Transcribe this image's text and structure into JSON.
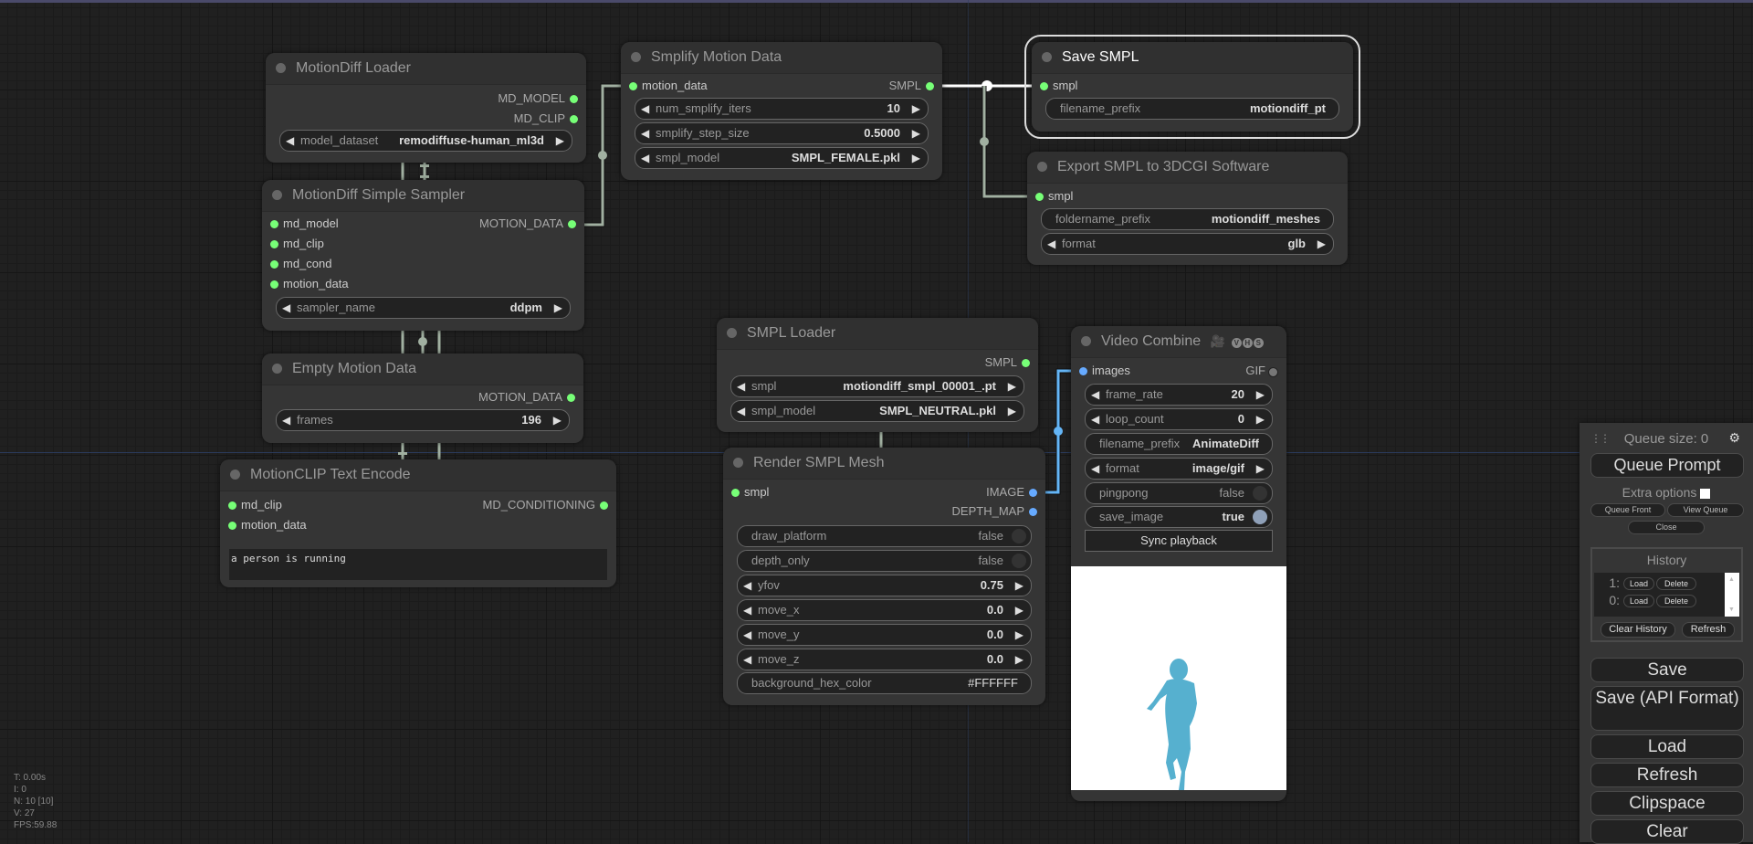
{
  "canvas": {
    "stats": [
      "T: 0.00s",
      "I: 0",
      "N: 10 [10]",
      "V: 27",
      "FPS:59.88"
    ]
  },
  "nodes": {
    "motiondiff_loader": {
      "title": "MotionDiff Loader",
      "outputs": [
        "MD_MODEL",
        "MD_CLIP"
      ],
      "widgets": [
        {
          "name": "model_dataset",
          "value": "remodiffuse-human_ml3d"
        }
      ]
    },
    "smplify": {
      "title": "Smplify Motion Data",
      "inputs": [
        "motion_data"
      ],
      "outputs": [
        "SMPL"
      ],
      "widgets": [
        {
          "name": "num_smplify_iters",
          "value": "10"
        },
        {
          "name": "smplify_step_size",
          "value": "0.5000"
        },
        {
          "name": "smpl_model",
          "value": "SMPL_FEMALE.pkl"
        }
      ]
    },
    "save_smpl": {
      "title": "Save SMPL",
      "inputs": [
        "smpl"
      ],
      "widgets": [
        {
          "name": "filename_prefix",
          "value": "motiondiff_pt"
        }
      ]
    },
    "export_smpl": {
      "title": "Export SMPL to 3DCGI Software",
      "inputs": [
        "smpl"
      ],
      "widgets": [
        {
          "name": "foldername_prefix",
          "value": "motiondiff_meshes"
        },
        {
          "name": "format",
          "value": "glb"
        }
      ]
    },
    "sampler": {
      "title": "MotionDiff Simple Sampler",
      "inputs": [
        "md_model",
        "md_clip",
        "md_cond",
        "motion_data"
      ],
      "outputs": [
        "MOTION_DATA"
      ],
      "widgets": [
        {
          "name": "sampler_name",
          "value": "ddpm"
        }
      ]
    },
    "empty_motion": {
      "title": "Empty Motion Data",
      "outputs": [
        "MOTION_DATA"
      ],
      "widgets": [
        {
          "name": "frames",
          "value": "196"
        }
      ]
    },
    "text_encode": {
      "title": "MotionCLIP Text Encode",
      "inputs": [
        "md_clip",
        "motion_data"
      ],
      "outputs": [
        "MD_CONDITIONING"
      ],
      "text": "a person is running"
    },
    "smpl_loader": {
      "title": "SMPL Loader",
      "outputs": [
        "SMPL"
      ],
      "widgets": [
        {
          "name": "smpl",
          "value": "motiondiff_smpl_00001_.pt"
        },
        {
          "name": "smpl_model",
          "value": "SMPL_NEUTRAL.pkl"
        }
      ]
    },
    "render_mesh": {
      "title": "Render SMPL Mesh",
      "inputs": [
        "smpl"
      ],
      "outputs": [
        "IMAGE",
        "DEPTH_MAP"
      ],
      "widgets": [
        {
          "name": "draw_platform",
          "value": "false"
        },
        {
          "name": "depth_only",
          "value": "false"
        },
        {
          "name": "yfov",
          "value": "0.75"
        },
        {
          "name": "move_x",
          "value": "0.0"
        },
        {
          "name": "move_y",
          "value": "0.0"
        },
        {
          "name": "move_z",
          "value": "0.0"
        },
        {
          "name": "background_hex_color",
          "value": "#FFFFFF"
        }
      ]
    },
    "video_combine": {
      "title": "Video Combine",
      "badges": [
        "V",
        "H",
        "S"
      ],
      "inputs": [
        "images"
      ],
      "outputs": [
        "GIF"
      ],
      "widgets": [
        {
          "name": "frame_rate",
          "value": "20"
        },
        {
          "name": "loop_count",
          "value": "0"
        },
        {
          "name": "filename_prefix",
          "value": "AnimateDiff"
        },
        {
          "name": "format",
          "value": "image/gif"
        },
        {
          "name": "pingpong",
          "value": "false"
        },
        {
          "name": "save_image",
          "value": "true"
        }
      ],
      "sync_label": "Sync playback"
    }
  },
  "menu": {
    "queue_size": "Queue size: 0",
    "queue_prompt": "Queue Prompt",
    "extra_options": "Extra options",
    "queue_front": "Queue Front",
    "view_queue": "View Queue",
    "close": "Close",
    "history_title": "History",
    "history": [
      {
        "num": "1:",
        "load": "Load",
        "delete": "Delete"
      },
      {
        "num": "0:",
        "load": "Load",
        "delete": "Delete"
      }
    ],
    "clear_history": "Clear History",
    "refresh_history": "Refresh",
    "buttons": [
      "Save",
      "Save (API Format)",
      "Load",
      "Refresh",
      "Clipspace",
      "Clear"
    ]
  },
  "colors": {
    "link_default": "#a1b0a1",
    "link_image": "#64b5f6",
    "link_selected": "#ffffff",
    "slot_green": "#77ff77",
    "slot_blue": "#66aaff"
  }
}
